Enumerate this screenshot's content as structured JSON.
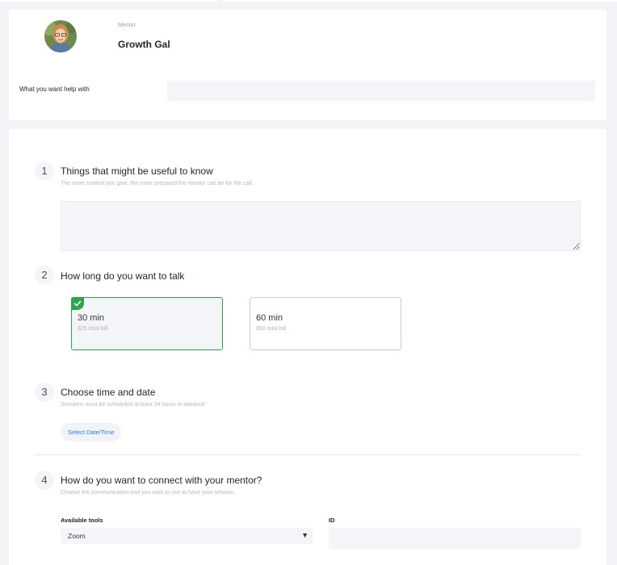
{
  "mentor": {
    "label": "Mentor",
    "name": "Growth Gal",
    "help_label": "What you want help with",
    "help_value": ""
  },
  "steps": [
    {
      "number": "1",
      "title": "Things that might be useful to know",
      "subtitle": "The more context you give, the more prepared the mentor can be for the call.",
      "notes_value": ""
    },
    {
      "number": "2",
      "title": "How long do you want to talk",
      "options": [
        {
          "label": "30 min",
          "sub": "$25 total bill",
          "selected": true
        },
        {
          "label": "60 min",
          "sub": "$50 total bill",
          "selected": false
        }
      ]
    },
    {
      "number": "3",
      "title": "Choose time and date",
      "subtitle": "Sessions must be scheduled at least 24 hours in advance",
      "button_label": "Select Date/Time"
    },
    {
      "number": "4",
      "title": "How do you want to connect with your mentor?",
      "subtitle": "Choose the communication tool you wish to use to have your session.",
      "tools_label": "Available tools",
      "tools_value": "Zoom",
      "id_label": "ID",
      "id_value": ""
    }
  ],
  "colors": {
    "selected_border": "#2ea44f",
    "link_blue": "#2f7be5",
    "field_bg": "#f4f5f8",
    "page_bg": "#f3f4f7"
  },
  "icons": {
    "selected_check": "check-icon",
    "dropdown": "caret-down-icon",
    "resize": "resize-grip-icon"
  }
}
